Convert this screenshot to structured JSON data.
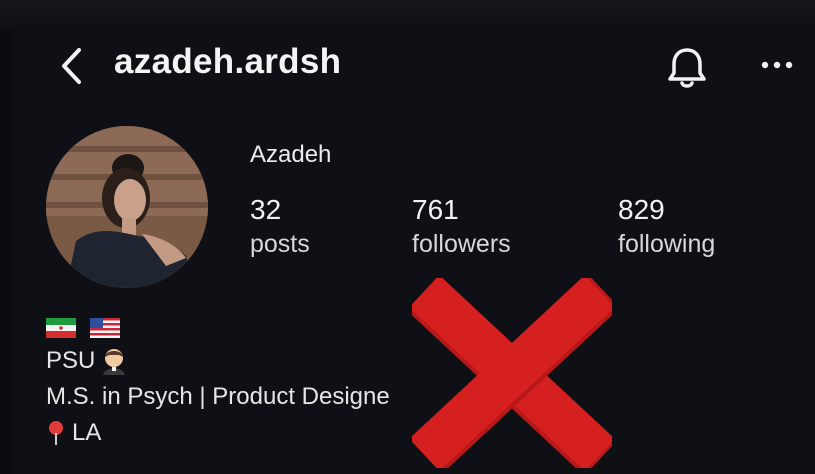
{
  "header": {
    "username": "azadeh.ardsh",
    "back_icon": "chevron-left-icon",
    "bell_icon": "bell-icon",
    "more_icon": "more-horizontal-icon"
  },
  "profile": {
    "display_name": "Azadeh",
    "stats": [
      {
        "value": "32",
        "label": "posts"
      },
      {
        "value": "761",
        "label": "followers"
      },
      {
        "value": "829",
        "label": "following"
      }
    ]
  },
  "bio": {
    "flags": [
      "iran-flag",
      "us-flag"
    ],
    "line1": "PSU",
    "line1_emoji": "student-emoji",
    "line2": "M.S. in Psych | Product Designe",
    "line3": "LA",
    "line3_icon": "map-pin-icon"
  },
  "overlay": {
    "icon": "red-x-mark",
    "color": "#d61f1f"
  },
  "colors": {
    "background": "#0f1015",
    "text": "#f2f2f2"
  }
}
